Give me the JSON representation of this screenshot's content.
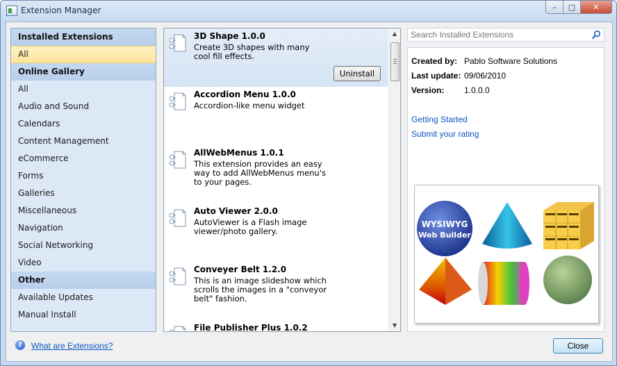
{
  "window": {
    "title": "Extension Manager"
  },
  "sidebar": {
    "sections": [
      {
        "header": "Installed Extensions",
        "items": [
          "All"
        ]
      },
      {
        "header": "Online Gallery",
        "items": [
          "All",
          "Audio and Sound",
          "Calendars",
          "Content Management",
          "eCommerce",
          "Forms",
          "Galleries",
          "Miscellaneous",
          "Navigation",
          "Social Networking",
          "Video"
        ]
      },
      {
        "header": "Other",
        "items": [
          "Available Updates",
          "Manual Install"
        ]
      }
    ],
    "selected": "All"
  },
  "extensions": [
    {
      "name": "3D Shape 1.0.0",
      "description": "Create 3D shapes with many\ncool fill effects.",
      "selected": true
    },
    {
      "name": "Accordion Menu 1.0.0",
      "description": "Accordion-like menu widget"
    },
    {
      "name": "AllWebMenus 1.0.1",
      "description": "This extension provides an easy\nway to add AllWebMenus menu's\nto your pages."
    },
    {
      "name": "Auto Viewer 2.0.0",
      "description": "AutoViewer is a Flash image\nviewer/photo gallery."
    },
    {
      "name": "Conveyer Belt 1.2.0",
      "description": "This is an image slideshow which\nscrolls the images in a \"conveyor\nbelt\" fashion."
    },
    {
      "name": "File Publisher Plus 1.0.2",
      "description": ""
    }
  ],
  "uninstall_label": "Uninstall",
  "search": {
    "placeholder": "Search Installed Extensions"
  },
  "details": {
    "created_by_label": "Created by:",
    "created_by": "Pablo Software Solutions",
    "last_update_label": "Last update:",
    "last_update": "09/06/2010",
    "version_label": "Version:",
    "version": "1.0.0.0",
    "links": [
      "Getting Started",
      "Submit your rating"
    ],
    "preview_logo_text": [
      "WYSIWYG",
      "Web Builder"
    ]
  },
  "footer": {
    "help_link": "What are Extensions?",
    "close_label": "Close"
  }
}
